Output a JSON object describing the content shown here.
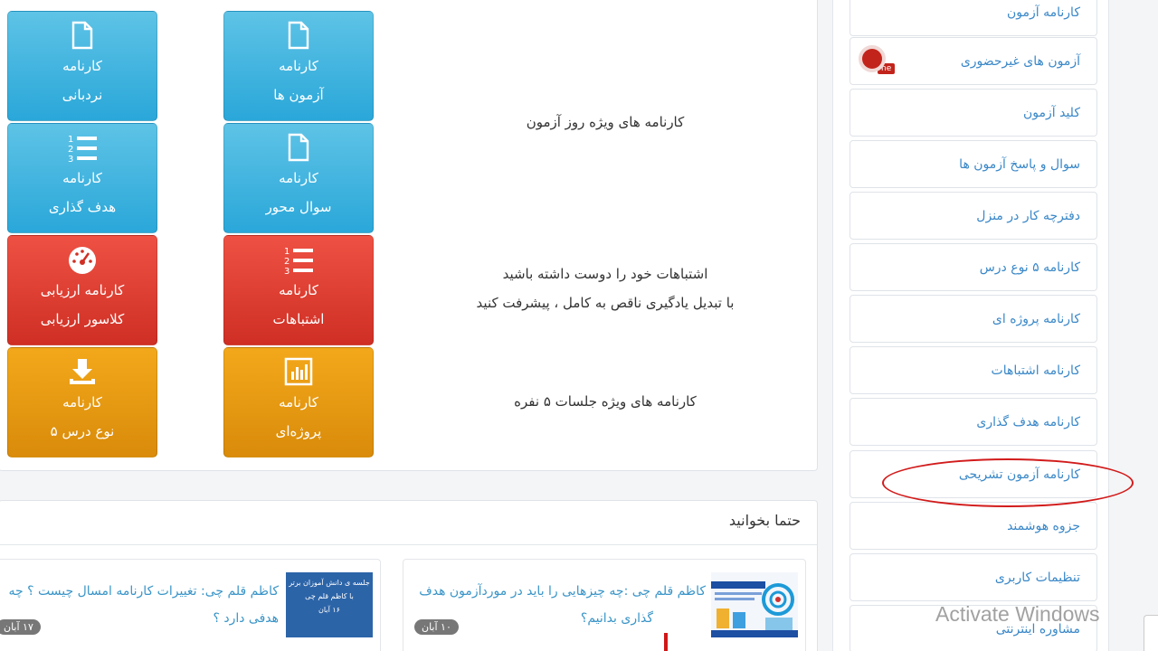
{
  "tiles": [
    {
      "id": "nardebani",
      "line1": "کارنامه",
      "line2": "نردبانی",
      "color": "#2aa7d9",
      "icon": "file-icon"
    },
    {
      "id": "azmoonha",
      "line1": "کارنامه",
      "line2": "آزمون ها",
      "color": "#2aa7d9",
      "icon": "file-icon"
    },
    {
      "id": "hadaf",
      "line1": "کارنامه",
      "line2": "هدف گذاری",
      "color": "#2aa7d9",
      "icon": "ordered-list-icon"
    },
    {
      "id": "soal",
      "line1": "کارنامه",
      "line2": "سوال محور",
      "color": "#2aa7d9",
      "icon": "file-icon"
    },
    {
      "id": "arzyabi",
      "line1": "کارنامه ارزیابی",
      "line2": "کلاسور ارزیابی",
      "color": "#cf2f24",
      "icon": "dashboard-gauge-icon"
    },
    {
      "id": "eshtebahat",
      "line1": "کارنامه",
      "line2": "اشتباهات",
      "color": "#cf2f24",
      "icon": "ordered-list-icon"
    },
    {
      "id": "panj",
      "line1": "کارنامه",
      "line2": "۵ نوع درس",
      "color": "#d98b0a",
      "icon": "download-icon"
    },
    {
      "id": "projeh",
      "line1": "کارنامه",
      "line2": "پروژه‌ای",
      "color": "#d98b0a",
      "icon": "bar-chart-icon"
    }
  ],
  "descriptions": {
    "row1": "کارنامه های ویژه روز آزمون",
    "row3_line1": "اشتباهات خود را دوست داشته باشید",
    "row3_line2": "با تبدیل یادگیری ناقص به کامل ، پیشرفت کنید",
    "row4": "کارنامه های ویژه جلسات ۵ نفره"
  },
  "read_section": {
    "title": "حتما بخوانید",
    "articles": [
      {
        "title_line1": "کاظم قلم چی :چه چیزهایی را باید در موردآزمون هدف",
        "title_line2": "گذاری بدانیم؟",
        "date": "۱۰ آبان"
      },
      {
        "title_line1": "کاظم قلم چی: تغییرات کارنامه امسال چیست ؟ چه",
        "title_line2": "هدفی دارد ؟",
        "date": "۱۷ آبان",
        "thumb_text_1": "جلسه ی دانش آموزان برتر",
        "thumb_text_2": "با کاظم قلم چی",
        "thumb_text_3": "۱۶ آبان"
      }
    ]
  },
  "sidebar": {
    "new_badge": "ne",
    "items": [
      "کارنامه آزمون",
      "آزمون های غیرحضوری",
      "کلید آزمون",
      "سوال و پاسخ آزمون ها",
      "دفترچه کار در منزل",
      "کارنامه ۵ نوع درس",
      "کارنامه پروژه ای",
      "کارنامه اشتباهات",
      "کارنامه هدف گذاری",
      "کارنامه آزمون تشریحی",
      "جزوه هوشمند",
      "تنظیمات کاربری",
      "مشاوره اینترنتی"
    ]
  },
  "watermark": "Activate Windows",
  "colors": {
    "blue": "#2aa7d9",
    "red": "#cf2f24",
    "orange": "#d98b0a",
    "link": "#3a88c8",
    "highlight": "#d21b1b"
  }
}
